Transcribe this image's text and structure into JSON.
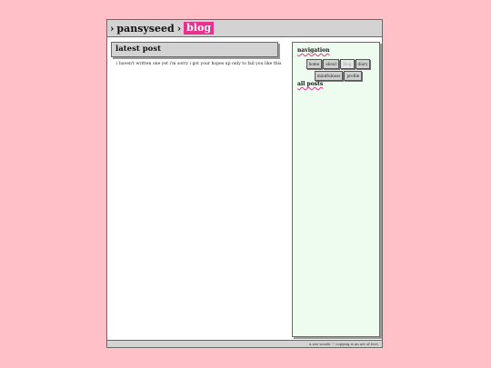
{
  "header": {
    "separator": "›",
    "site_name": "pansyseed",
    "current_section": "blog"
  },
  "main": {
    "heading": "latest post",
    "post_text": "i haven't written one yet i'm sorry i got your hopes up only to fail you like this"
  },
  "sidebar": {
    "navigation_title": "navigation",
    "nav_buttons": [
      "home",
      "about",
      "blog",
      "diary",
      "mindfulness",
      "profile"
    ],
    "current_nav": "blog",
    "all_posts_title": "all posts"
  },
  "footer": {
    "text": "a.zee woods ♡ copying is an act of love."
  },
  "colors": {
    "background": "#ffc0c8",
    "accent": "#e8318f",
    "panel_gray": "#d3d3d3",
    "sidebar_bg": "#eefcf0"
  }
}
